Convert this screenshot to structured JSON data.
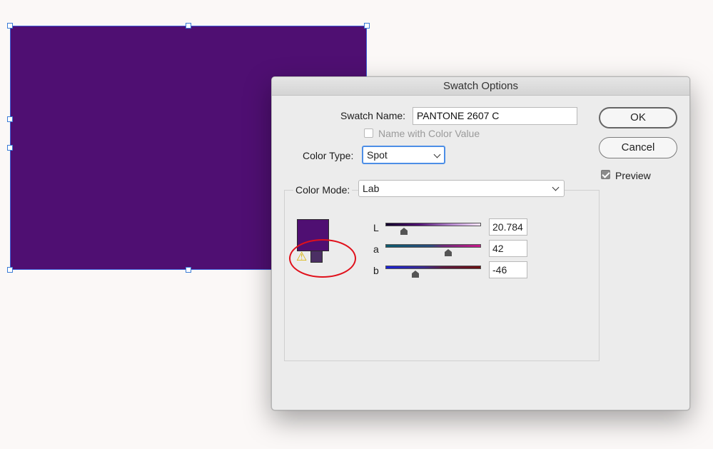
{
  "dialog": {
    "title": "Swatch Options",
    "swatch_name_label": "Swatch Name:",
    "swatch_name_value": "PANTONE 2607 C",
    "name_with_color_value_label": "Name with Color Value",
    "color_type_label": "Color Type:",
    "color_type_value": "Spot",
    "color_mode_label": "Color Mode:",
    "color_mode_value": "Lab",
    "ok_label": "OK",
    "cancel_label": "Cancel",
    "preview_label": "Preview",
    "preview_checked": true,
    "name_with_color_value_checked": false
  },
  "sliders": [
    {
      "label": "L",
      "value": "20.784",
      "fraction": 0.2
    },
    {
      "label": "a",
      "value": "42",
      "fraction": 0.66
    },
    {
      "label": "b",
      "value": "-46",
      "fraction": 0.32
    }
  ],
  "colors": {
    "swatch": "#4f0f72",
    "out_of_gamut_swatch": "#4b2f64",
    "annotation_circle": "#e0101b",
    "selection_handle": "#3a7bd6"
  },
  "icons": {
    "gamut_warning": "⚠"
  }
}
